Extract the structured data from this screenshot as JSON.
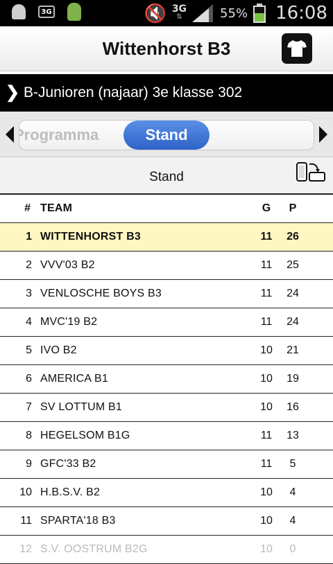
{
  "status_bar": {
    "network": "3G",
    "battery": "55%",
    "battery_level": 0.55,
    "time": "16:08",
    "icons": [
      "ghost-icon",
      "3g-box-icon",
      "android-icon",
      "mute-icon",
      "signal-icon",
      "battery-icon"
    ]
  },
  "header": {
    "title": "Wittenhorst B3",
    "shirt_icon": "shirt-icon"
  },
  "league": {
    "name": "B-Junioren (najaar) 3e klasse 302"
  },
  "tabs": {
    "prev": "Programma",
    "active": "Stand"
  },
  "section": {
    "label": "Stand",
    "rotate_icon": "rotate-phone-icon"
  },
  "table": {
    "columns": {
      "num": "#",
      "team": "TEAM",
      "g": "G",
      "p": "P"
    },
    "rows": [
      {
        "num": "1",
        "team": "WITTENHORST B3",
        "g": "11",
        "p": "26",
        "highlight": true
      },
      {
        "num": "2",
        "team": "VVV'03 B2",
        "g": "11",
        "p": "25"
      },
      {
        "num": "3",
        "team": "VENLOSCHE BOYS B3",
        "g": "11",
        "p": "24"
      },
      {
        "num": "4",
        "team": "MVC'19 B2",
        "g": "11",
        "p": "24"
      },
      {
        "num": "5",
        "team": "IVO B2",
        "g": "10",
        "p": "21"
      },
      {
        "num": "6",
        "team": "AMERICA B1",
        "g": "10",
        "p": "19"
      },
      {
        "num": "7",
        "team": "SV LOTTUM B1",
        "g": "10",
        "p": "16"
      },
      {
        "num": "8",
        "team": "HEGELSOM B1G",
        "g": "11",
        "p": "13"
      },
      {
        "num": "9",
        "team": "GFC'33 B2",
        "g": "11",
        "p": "5"
      },
      {
        "num": "10",
        "team": "H.B.S.V. B2",
        "g": "10",
        "p": "4"
      },
      {
        "num": "11",
        "team": "SPARTA'18 B3",
        "g": "10",
        "p": "4"
      },
      {
        "num": "12",
        "team": "S.V. OOSTRUM B2G",
        "g": "10",
        "p": "0"
      }
    ]
  },
  "colors": {
    "accent": "#2d63c8",
    "highlight_row": "#fff7c2",
    "header_bar": "#000000"
  }
}
